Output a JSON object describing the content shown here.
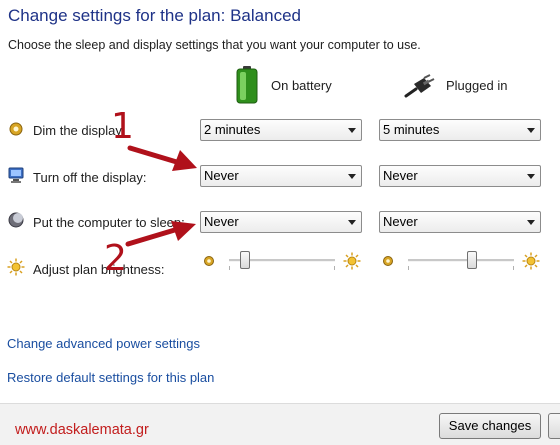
{
  "header": {
    "title": "Change settings for the plan: Balanced",
    "subtitle": "Choose the sleep and display settings that you want your computer to use."
  },
  "columns": {
    "battery": {
      "label": "On battery",
      "icon": "battery-icon"
    },
    "plugged": {
      "label": "Plugged in",
      "icon": "power-plug-icon"
    }
  },
  "rows": {
    "dim": {
      "label": "Dim the display:",
      "icon": "dim-display-icon",
      "battery": "2 minutes",
      "plugged": "5 minutes"
    },
    "off": {
      "label": "Turn off the display:",
      "icon": "monitor-icon",
      "battery": "Never",
      "plugged": "Never"
    },
    "sleep": {
      "label": "Put the computer to sleep:",
      "icon": "sleep-moon-icon",
      "battery": "Never",
      "plugged": "Never"
    },
    "brightness": {
      "label": "Adjust plan brightness:",
      "icon": "brightness-sun-icon",
      "battery_level": 0.15,
      "plugged_level": 0.6
    }
  },
  "links": {
    "advanced": "Change advanced power settings",
    "restore": "Restore default settings for this plan"
  },
  "annotations": {
    "first": "1",
    "second": "2",
    "color": "#b0111b"
  },
  "footer": {
    "watermark": "www.daskalemata.gr",
    "save": "Save changes"
  }
}
